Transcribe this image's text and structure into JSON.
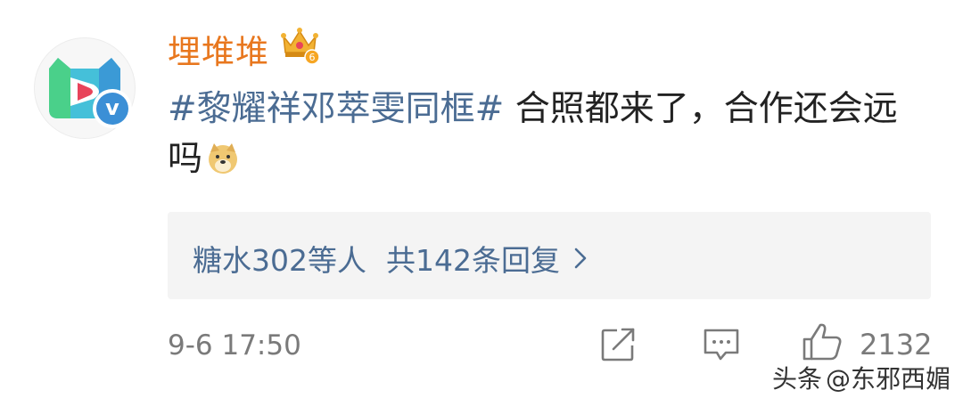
{
  "user": {
    "name": "埋堆堆",
    "level_badge": "6",
    "avatar_icon": "maiduidui-logo",
    "verified_mark": "v"
  },
  "post": {
    "hashtag": "#黎耀祥邓萃雯同框#",
    "text": " 合照都来了，合作还会远吗",
    "emoji": "doge-emoji"
  },
  "replies": {
    "names": "糖水302等人",
    "count_text": "共142条回复",
    "chevron": "›"
  },
  "meta": {
    "timestamp": "9-6 17:50",
    "like_count": "2132"
  },
  "watermark": {
    "source": "头条",
    "handle": "@东邪西媚"
  },
  "colors": {
    "username": "#e8771e",
    "link": "#4b6c93",
    "text": "#222222",
    "muted": "#7a7a7a",
    "verified": "#3b8fd6"
  }
}
